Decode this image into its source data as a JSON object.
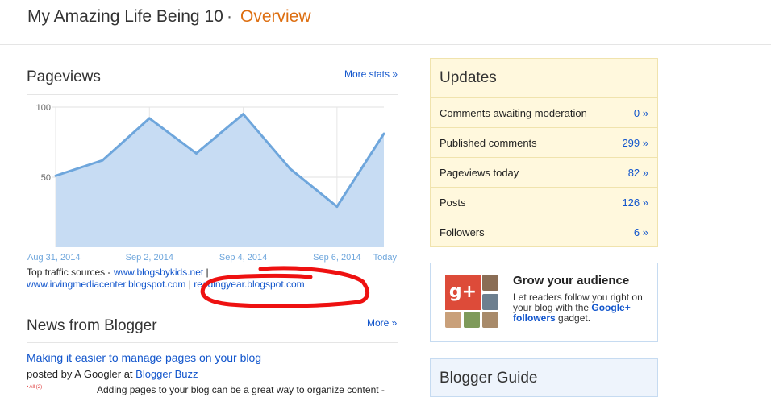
{
  "header": {
    "blog_title": "My Amazing Life Being 10",
    "separator": "·",
    "section": "Overview"
  },
  "pageviews": {
    "title": "Pageviews",
    "more_label": "More stats »",
    "chart_data": {
      "type": "area",
      "x": [
        "Aug 31, 2014",
        "Sep 1, 2014",
        "Sep 2, 2014",
        "Sep 3, 2014",
        "Sep 4, 2014",
        "Sep 5, 2014",
        "Sep 6, 2014",
        "Sep 7, 2014",
        "Today"
      ],
      "tick_labels": [
        "Aug 31, 2014",
        "Sep 2, 2014",
        "Sep 4, 2014",
        "Sep 6, 2014",
        "Today"
      ],
      "y_ticks": [
        "100",
        "50"
      ],
      "values": [
        51,
        62,
        92,
        67,
        95,
        56,
        29,
        81
      ],
      "ylim": [
        0,
        100
      ],
      "color": "#6ea6dc",
      "fill": "#c7dcf3"
    },
    "sources_prefix": "Top traffic sources - ",
    "sources": [
      "www.blogsbykids.net",
      "www.irvingmediacenter.blogspot.com",
      "readingyear.blogspot.com"
    ],
    "sources_sep": " | "
  },
  "news": {
    "title": "News from Blogger",
    "more_label": "More »",
    "post_title": "Making it easier to manage pages on your blog",
    "posted_prefix": "posted by A Googler at ",
    "posted_source": "Blogger Buzz",
    "tiny_label": "• All (2)",
    "excerpt": "Adding pages to your blog can be a great way to organize content -"
  },
  "updates": {
    "title": "Updates",
    "rows": [
      {
        "label": "Comments awaiting moderation",
        "value": "0 »"
      },
      {
        "label": "Published comments",
        "value": "299 »"
      },
      {
        "label": "Pageviews today",
        "value": "82 »"
      },
      {
        "label": "Posts",
        "value": "126 »"
      },
      {
        "label": "Followers",
        "value": "6 »"
      }
    ]
  },
  "grow": {
    "icon_text": "g+",
    "title": "Grow your audience",
    "text_before": "Let readers follow you right on your blog with the ",
    "link": "Google+ followers",
    "text_after": " gadget."
  },
  "guide": {
    "title": "Blogger Guide"
  },
  "colors": {
    "accent_orange": "#dd6e10",
    "link_blue": "#1155cc",
    "annotation_red": "#ee1111"
  }
}
